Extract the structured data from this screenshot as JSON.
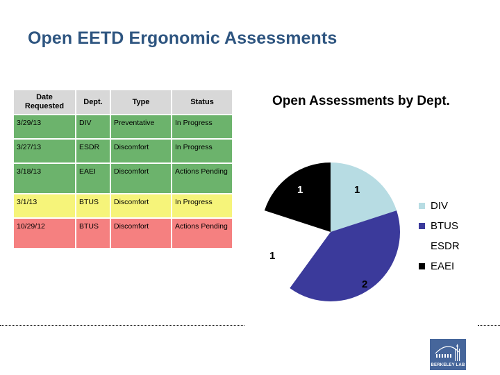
{
  "slide": {
    "title": "Open EETD Ergonomic Assessments",
    "title_color": "#2e5580",
    "background": "#ffffff"
  },
  "table": {
    "headers": [
      "Date Requested",
      "Dept.",
      "Type",
      "Status"
    ],
    "header_bg": "#d8d8d8",
    "row_colors": {
      "green": "#6cb36c",
      "yellow": "#f6f47a",
      "red": "#f58080"
    },
    "rows": [
      {
        "date": "3/29/13",
        "dept": "DIV",
        "type": "Preventative",
        "status": "In Progress",
        "color": "green"
      },
      {
        "date": "3/27/13",
        "dept": "ESDR",
        "type": "Discomfort",
        "status": "In Progress",
        "color": "green"
      },
      {
        "date": "3/18/13",
        "dept": "EAEI",
        "type": "Discomfort",
        "status": "Actions Pending",
        "color": "green"
      },
      {
        "date": "3/1/13",
        "dept": "BTUS",
        "type": "Discomfort",
        "status": "In Progress",
        "color": "yellow"
      },
      {
        "date": "10/29/12",
        "dept": "BTUS",
        "type": "Discomfort",
        "status": "Actions Pending",
        "color": "red"
      }
    ]
  },
  "chart_data": {
    "type": "pie",
    "title": "Open Assessments by Dept.",
    "categories": [
      "DIV",
      "BTUS",
      "ESDR",
      "EAEI"
    ],
    "values": [
      1,
      2,
      1,
      1
    ],
    "total": 5,
    "colors": [
      "#b7dce3",
      "#3b3a9b",
      "#ffffff",
      "#000000"
    ],
    "data_labels": [
      "1",
      "2",
      "1",
      "1"
    ],
    "label_colors": [
      "#000000",
      "#000000",
      "#000000",
      "#ffffff"
    ],
    "start_angle_deg": 0,
    "legend_position": "right",
    "legend": [
      {
        "label": "DIV",
        "color": "#b7dce3"
      },
      {
        "label": "BTUS",
        "color": "#3b3a9b"
      },
      {
        "label": "ESDR",
        "color": "#ffffff"
      },
      {
        "label": "EAEI",
        "color": "#000000"
      }
    ]
  },
  "footer": {
    "logo_text": "BERKELEY LAB",
    "logo_bg": "#46669b"
  }
}
